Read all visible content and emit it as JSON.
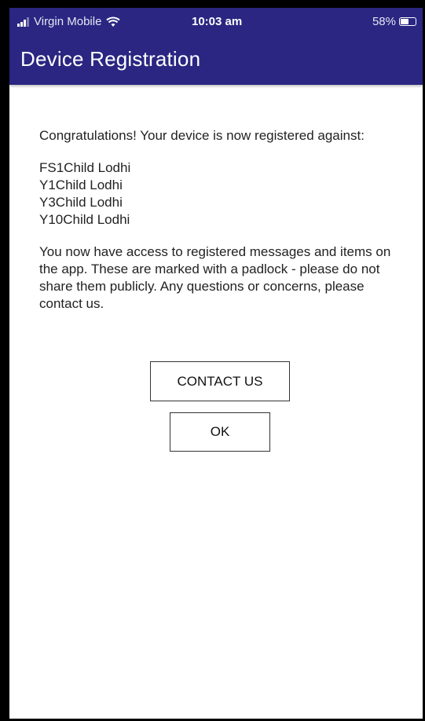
{
  "status_bar": {
    "carrier": "Virgin Mobile",
    "time": "10:03 am",
    "battery_percent": "58%",
    "battery_level": 0.58,
    "icons": [
      "signal-icon",
      "wifi-icon",
      "battery-icon"
    ]
  },
  "header": {
    "title": "Device Registration",
    "background_color": "#2a2682"
  },
  "main": {
    "intro": "Congratulations! Your device is now registered against:",
    "registered_children": [
      "FS1Child Lodhi",
      "Y1Child Lodhi",
      "Y3Child Lodhi",
      "Y10Child Lodhi"
    ],
    "info": "You now have access to registered messages and items on the app. These are marked with a padlock - please do not share them publicly. Any questions or concerns, please contact us."
  },
  "actions": {
    "contact_label": "CONTACT US",
    "ok_label": "OK"
  }
}
